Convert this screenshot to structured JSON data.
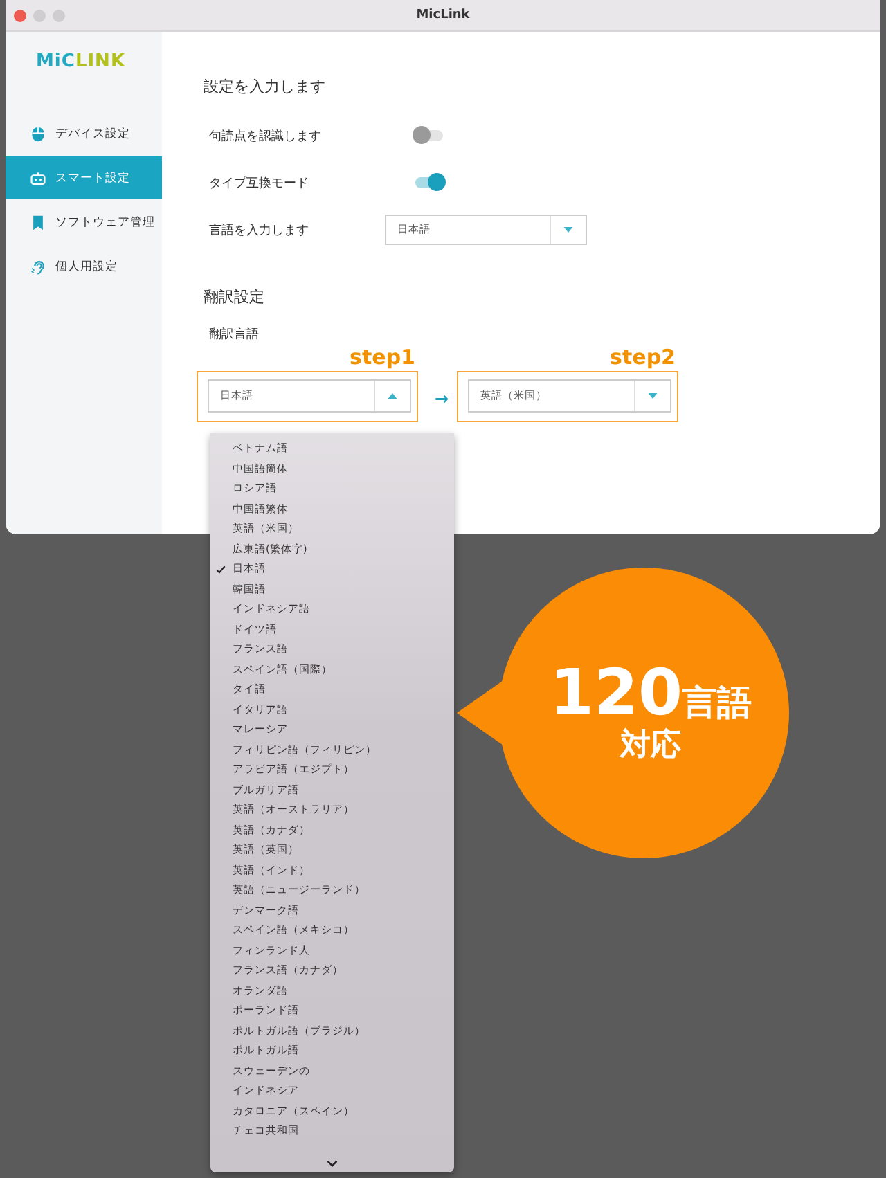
{
  "window": {
    "title": "MicLink"
  },
  "logo": {
    "part1": "MiC",
    "part2": "LINK"
  },
  "sidebar": {
    "items": [
      {
        "label": "デバイス設定",
        "selected": false
      },
      {
        "label": "スマート設定",
        "selected": true
      },
      {
        "label": "ソフトウェア管理",
        "selected": false
      },
      {
        "label": "個人用設定",
        "selected": false
      }
    ]
  },
  "input_settings": {
    "heading": "設定を入力します",
    "rows": [
      {
        "kind": "toggle",
        "label": "句読点を認識します",
        "on": false
      },
      {
        "kind": "toggle",
        "label": "タイプ互換モード",
        "on": true
      },
      {
        "kind": "select",
        "label": "言語を入力します",
        "value": "日本語"
      }
    ]
  },
  "translation": {
    "heading": "翻訳設定",
    "label": "翻訳言語",
    "arrow": "→",
    "source": {
      "step": "step1",
      "value": "日本語",
      "expanded": true
    },
    "target": {
      "step": "step2",
      "value": "英語（米国）",
      "expanded": false
    }
  },
  "dropdown": {
    "items": [
      {
        "label": "ベトナム語",
        "selected": false
      },
      {
        "label": "中国語簡体",
        "selected": false
      },
      {
        "label": "ロシア語",
        "selected": false
      },
      {
        "label": "中国語繁体",
        "selected": false
      },
      {
        "label": "英語（米国）",
        "selected": false
      },
      {
        "label": "広東語(繁体字)",
        "selected": false
      },
      {
        "label": "日本語",
        "selected": true
      },
      {
        "label": "韓国語",
        "selected": false
      },
      {
        "label": "インドネシア語",
        "selected": false
      },
      {
        "label": "ドイツ語",
        "selected": false
      },
      {
        "label": "フランス語",
        "selected": false
      },
      {
        "label": "スペイン語（国際）",
        "selected": false
      },
      {
        "label": "タイ語",
        "selected": false
      },
      {
        "label": "イタリア語",
        "selected": false
      },
      {
        "label": "マレーシア",
        "selected": false
      },
      {
        "label": "フィリピン語（フィリピン）",
        "selected": false
      },
      {
        "label": "アラビア語（エジプト）",
        "selected": false
      },
      {
        "label": "ブルガリア語",
        "selected": false
      },
      {
        "label": "英語（オーストラリア）",
        "selected": false
      },
      {
        "label": "英語（カナダ）",
        "selected": false
      },
      {
        "label": "英語（英国）",
        "selected": false
      },
      {
        "label": "英語（インド）",
        "selected": false
      },
      {
        "label": "英語（ニュージーランド）",
        "selected": false
      },
      {
        "label": "デンマーク語",
        "selected": false
      },
      {
        "label": "スペイン語（メキシコ）",
        "selected": false
      },
      {
        "label": "フィンランド人",
        "selected": false
      },
      {
        "label": "フランス語（カナダ）",
        "selected": false
      },
      {
        "label": "オランダ語",
        "selected": false
      },
      {
        "label": "ポーランド語",
        "selected": false
      },
      {
        "label": "ポルトガル語（ブラジル）",
        "selected": false
      },
      {
        "label": "ポルトガル語",
        "selected": false
      },
      {
        "label": "スウェーデンの",
        "selected": false
      },
      {
        "label": "インドネシア",
        "selected": false
      },
      {
        "label": "カタロニア（スペイン）",
        "selected": false
      },
      {
        "label": "チェコ共和国",
        "selected": false
      }
    ]
  },
  "callout": {
    "number": "120",
    "unit": "言語",
    "line2": "対応"
  }
}
